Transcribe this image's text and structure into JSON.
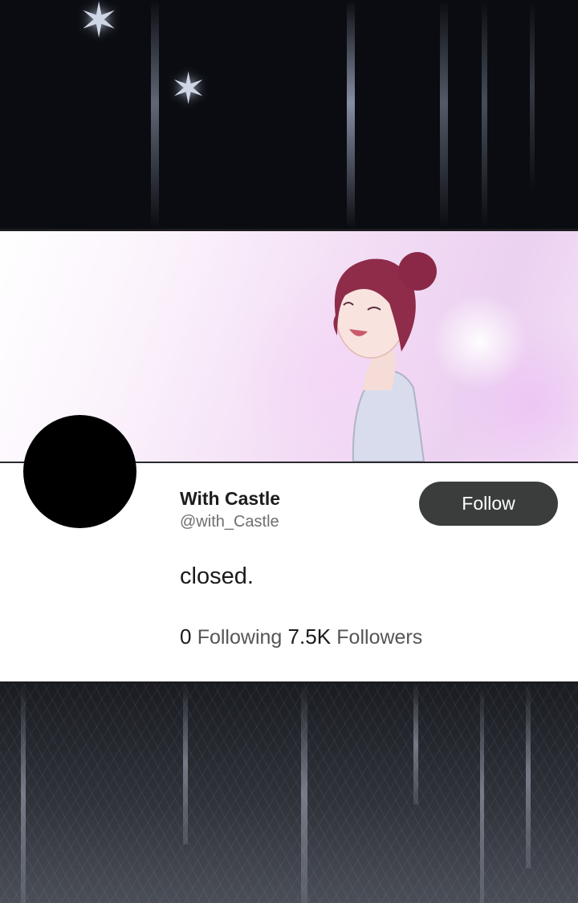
{
  "profile": {
    "display_name": "With Castle",
    "handle": "@with_Castle",
    "bio": "closed.",
    "follow_label": "Follow",
    "following_count": "0",
    "following_label": "Following",
    "followers_count": "7.5K",
    "followers_label": "Followers"
  },
  "icons": {
    "sparkle": "✶"
  },
  "colors": {
    "follow_button": "#3b3d3d",
    "avatar": "#000000",
    "banner_tint": "#ecd1f1"
  }
}
